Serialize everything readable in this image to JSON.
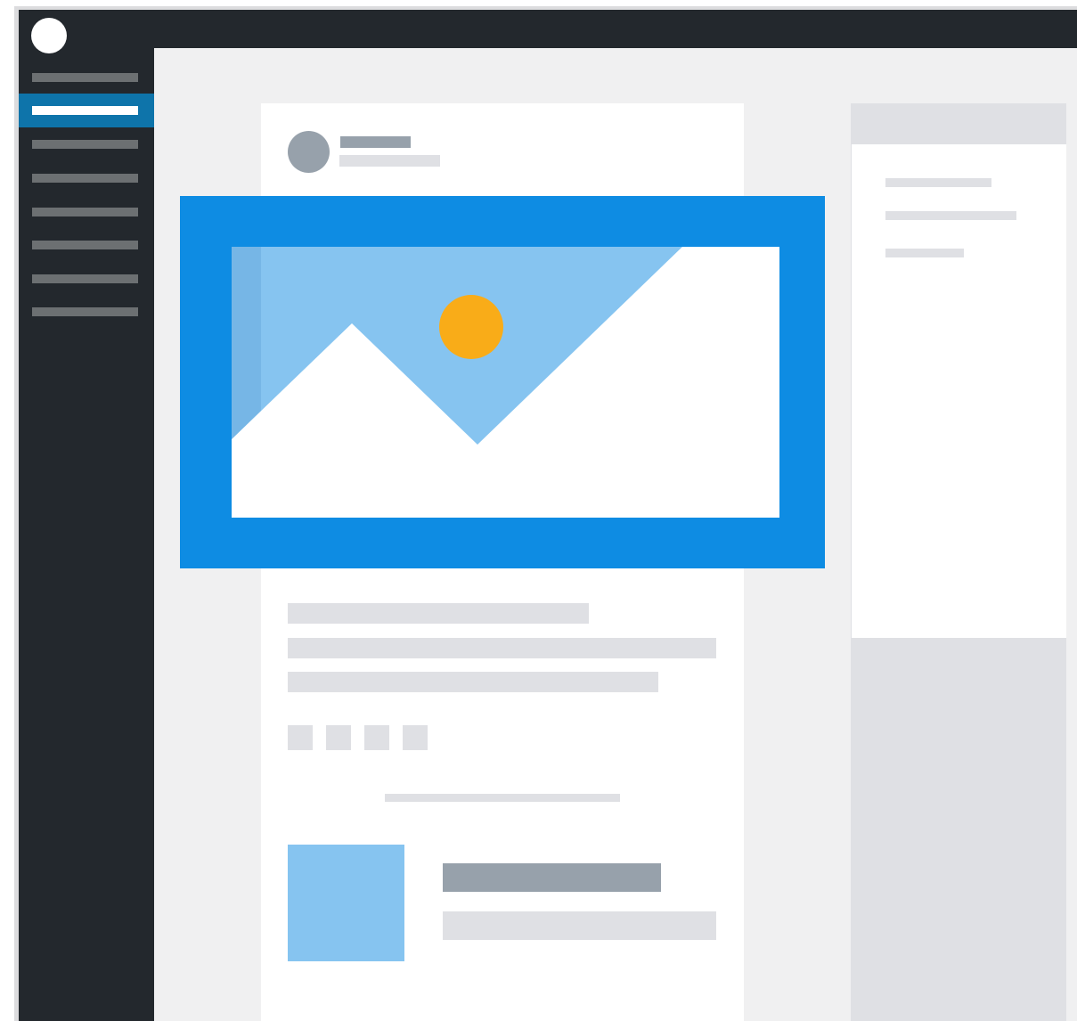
{
  "app": {
    "logo_icon": "wordpress-logo-icon"
  },
  "sidebar": {
    "background_color": "#23282d",
    "active_color": "#0e74aa",
    "items": [
      {
        "icon": "menu-placeholder",
        "active": false
      },
      {
        "icon": "menu-placeholder",
        "active": true
      },
      {
        "icon": "menu-placeholder",
        "active": false
      },
      {
        "icon": "menu-placeholder",
        "active": false
      },
      {
        "icon": "menu-placeholder",
        "active": false
      },
      {
        "icon": "menu-placeholder",
        "active": false
      },
      {
        "icon": "menu-placeholder",
        "active": false
      },
      {
        "icon": "menu-placeholder",
        "active": false
      }
    ]
  },
  "post": {
    "author_avatar": "avatar-placeholder",
    "featured_image": {
      "icon": "image-placeholder-icon",
      "highlight_color": "#0e8ce3",
      "sky_color": "#86c4f0",
      "sun_color": "#f9ac18"
    },
    "share_buttons": [
      "share-placeholder",
      "share-placeholder",
      "share-placeholder",
      "share-placeholder"
    ],
    "related_thumbnail_color": "#86c4f0"
  },
  "colors": {
    "placeholder_dark": "#97a1ab",
    "placeholder_light": "#dfe0e4",
    "canvas": "#f0f0f1"
  }
}
